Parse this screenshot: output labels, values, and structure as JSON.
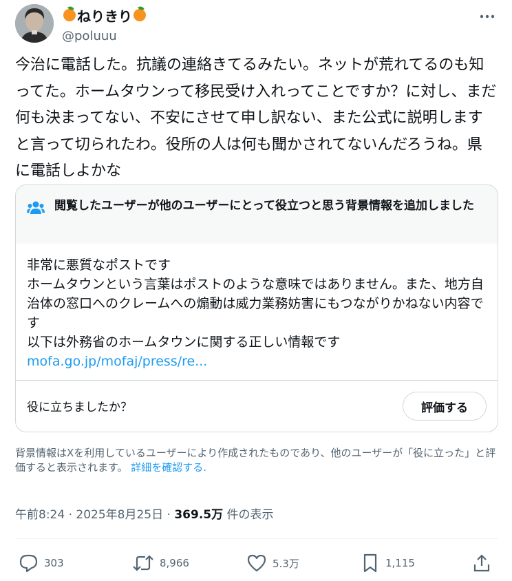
{
  "user": {
    "display_name": "ねりきり",
    "handle": "@poluuu",
    "name_decoration": "orange-emoji"
  },
  "post": {
    "text": "今治に電話した。抗議の連絡きてるみたい。ネットが荒れてるのも知ってた。ホームタウンって移民受け入れってことですか？に対し、まだ何も決まってない、不安にさせて申し訳ない、また公式に説明しますと言って切られたわ。役所の人は何も聞かされてないんだろうね。県に電話しよかな"
  },
  "community_note": {
    "title": "閲覧したユーザーが他のユーザーにとって役立つと思う背景情報を追加しました",
    "lines": [
      "非常に悪質なポストです",
      "ホームタウンという言葉はポストのような意味ではありません。また、地方自治体の窓口へのクレームへの煽動は威力業務妨害にもつながりかねない内容です",
      "以下は外務省のホームタウンに関する正しい情報です"
    ],
    "link": "mofa.go.jp/mofaj/press/re...",
    "question": "役に立ちましたか？",
    "rate_label": "評価する"
  },
  "disclaimer": {
    "text": "背景情報はXを利用しているユーザーにより作成されたものであり、他のユーザーが「役に立った」と評価すると表示されます。",
    "link": "詳細を確認する."
  },
  "meta": {
    "time": "午前8:24",
    "date": "2025年8月25日",
    "views_count": "369.5万",
    "views_label": "件の表示"
  },
  "actions": {
    "replies": "303",
    "reposts": "8,966",
    "likes": "5.3万",
    "bookmarks": "1,115"
  },
  "colors": {
    "accent": "#1d9bf0",
    "secondary_text": "#536471",
    "border": "#cfd9de",
    "note_header_bg": "#f7f9f9"
  }
}
